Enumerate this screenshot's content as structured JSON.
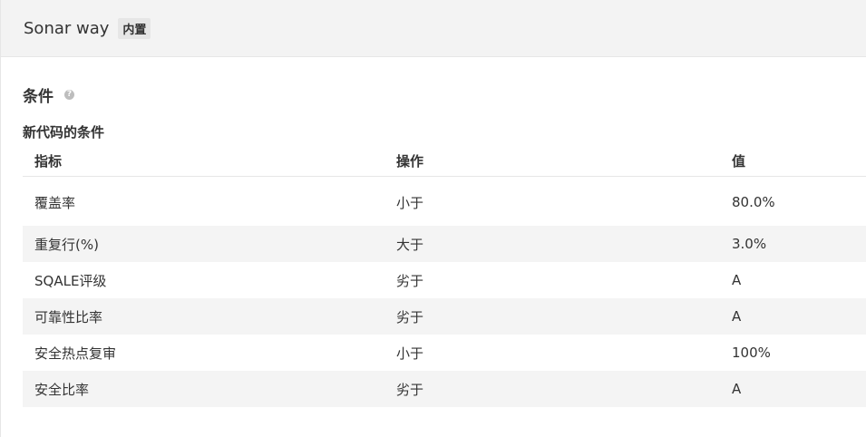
{
  "header": {
    "title": "Sonar way",
    "badge": "内置"
  },
  "section": {
    "title": "条件",
    "help_icon": "question-circle-icon"
  },
  "new_code": {
    "title": "新代码的条件",
    "columns": [
      "指标",
      "操作",
      "值"
    ],
    "rows": [
      {
        "metric": "覆盖率",
        "operator": "小于",
        "value": "80.0%"
      },
      {
        "metric": "重复行(%)",
        "operator": "大于",
        "value": "3.0%"
      },
      {
        "metric": "SQALE评级",
        "operator": "劣于",
        "value": "A"
      },
      {
        "metric": "可靠性比率",
        "operator": "劣于",
        "value": "A"
      },
      {
        "metric": "安全热点复审",
        "operator": "小于",
        "value": "100%"
      },
      {
        "metric": "安全比率",
        "operator": "劣于",
        "value": "A"
      }
    ]
  }
}
